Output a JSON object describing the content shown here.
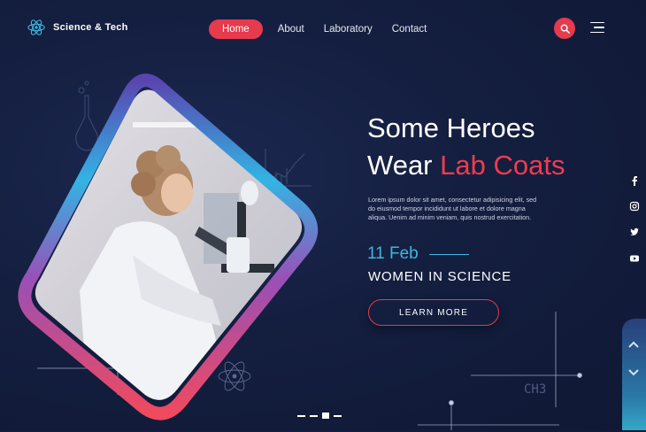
{
  "brand": {
    "name": "Science & Tech",
    "icon": "atom-icon"
  },
  "nav": {
    "items": [
      {
        "label": "Home",
        "active": true
      },
      {
        "label": "About",
        "active": false
      },
      {
        "label": "Laboratory",
        "active": false
      },
      {
        "label": "Contact",
        "active": false
      }
    ]
  },
  "header": {
    "search_icon": "search-icon",
    "menu_icon": "hamburger-menu-icon"
  },
  "hero": {
    "title_line1": "Some Heroes",
    "title_line2_prefix": "Wear ",
    "title_line2_accent": "Lab Coats",
    "description": "Lorem ipsum dolor sit amet, consectetur adipisicing elit, sed do eiusmod tempor incididunt ut labore et dolore magna aliqua. Uenim ad minim veniam, quis nostrud exercitation.",
    "date": "11 Feb",
    "event": "WOMEN IN SCIENCE",
    "cta_label": "LEARN MORE"
  },
  "decor_formula": "CH3",
  "social": [
    {
      "icon": "facebook-icon",
      "glyph": "f"
    },
    {
      "icon": "instagram-icon",
      "glyph": ""
    },
    {
      "icon": "twitter-icon",
      "glyph": ""
    },
    {
      "icon": "youtube-icon",
      "glyph": ""
    }
  ],
  "slider": {
    "count": 4,
    "active_index": 2
  },
  "colors": {
    "background": "#141e3f",
    "accent": "#e63a4d",
    "date": "#3fb6de"
  }
}
